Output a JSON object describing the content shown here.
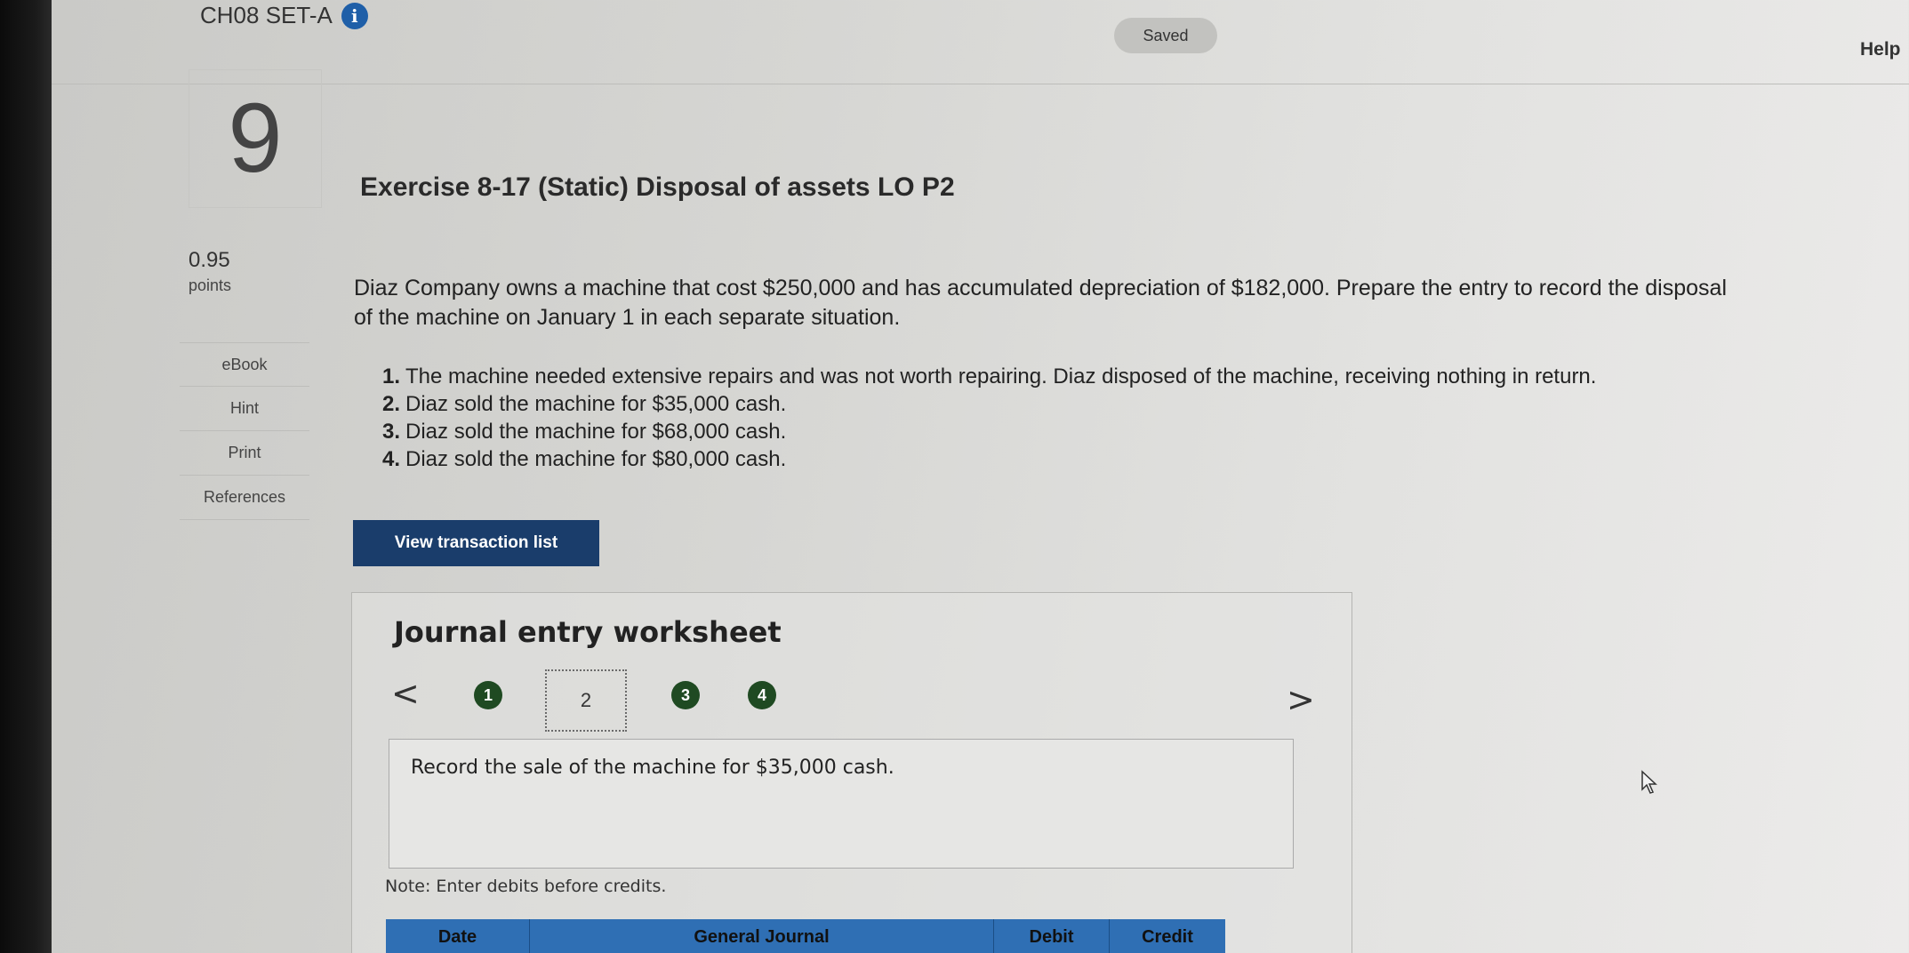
{
  "header": {
    "assignment_title": "CH08 SET-A",
    "info_icon": "info-icon",
    "saved_label": "Saved",
    "help_label": "Help"
  },
  "question": {
    "number": "9",
    "title": "Exercise 8-17 (Static) Disposal of assets LO P2",
    "points_value": "0.95",
    "points_label": "points"
  },
  "sidebar": {
    "items": [
      {
        "label": "eBook"
      },
      {
        "label": "Hint"
      },
      {
        "label": "Print"
      },
      {
        "label": "References"
      }
    ]
  },
  "problem": {
    "text": "Diaz Company owns a machine that cost $250,000 and has accumulated depreciation of $182,000. Prepare the entry to record the disposal of the machine on January 1 in each separate situation.",
    "requirements": [
      {
        "num": "1.",
        "text": "The machine needed extensive repairs and was not worth repairing. Diaz disposed of the machine, receiving nothing in return."
      },
      {
        "num": "2.",
        "text": "Diaz sold the machine for $35,000 cash."
      },
      {
        "num": "3.",
        "text": "Diaz sold the machine for $68,000 cash."
      },
      {
        "num": "4.",
        "text": "Diaz sold the machine for $80,000 cash."
      }
    ]
  },
  "actions": {
    "view_transaction_list": "View transaction list"
  },
  "worksheet": {
    "title": "Journal entry worksheet",
    "prev_glyph": "<",
    "next_glyph": ">",
    "steps": [
      "1",
      "2",
      "3",
      "4"
    ],
    "current_step": "2",
    "instruction": "Record the sale of the machine for $35,000 cash.",
    "note": "Note: Enter debits before credits.",
    "columns": [
      "Date",
      "General Journal",
      "Debit",
      "Credit"
    ]
  },
  "colors": {
    "primary_button": "#1a3d6b",
    "step_done": "#1f4a22",
    "table_header": "#2f6fb4",
    "info_icon": "#1f5fa8"
  }
}
